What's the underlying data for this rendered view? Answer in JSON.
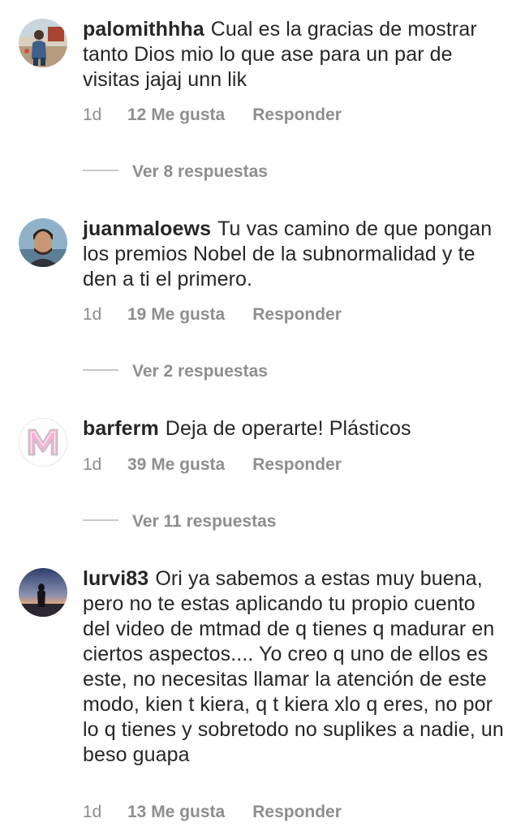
{
  "comments": [
    {
      "username": "palomithhha",
      "text": "Cual es la gracias de mostrar tanto Dios mio lo que ase para un par de visitas jajaj unn lik",
      "time": "1d",
      "likes": "12 Me gusta",
      "reply": "Responder",
      "view_replies": "Ver 8 respuestas",
      "avatar_icon": "avatar-photo-person-outdoors"
    },
    {
      "username": "juanmaloews",
      "text": "Tu vas camino de que pongan los premios Nobel de la subnormalidad y te den a ti el primero.",
      "time": "1d",
      "likes": "19 Me gusta",
      "reply": "Responder",
      "view_replies": "Ver 2 respuestas",
      "avatar_icon": "avatar-photo-man-portrait"
    },
    {
      "username": "barferm",
      "text": "Deja de operarte! Plásticos",
      "time": "1d",
      "likes": "39 Me gusta",
      "reply": "Responder",
      "view_replies": "Ver 11 respuestas",
      "avatar_icon": "avatar-letter-m"
    },
    {
      "username": "lurvi83",
      "text": "Ori ya sabemos a estas muy buena, pero no te estas aplicando tu propio cuento del video de mtmad de q tienes q madurar en ciertos aspectos.... Yo creo q uno de ellos es este, no necesitas llamar la atención de este modo, kien t kiera, q t kiera xlo q eres, no por lo q tienes y sobretodo no suplikes a nadie, un beso guapa",
      "time": "1d",
      "likes": "13 Me gusta",
      "reply": "Responder",
      "avatar_icon": "avatar-photo-sunset-silhouette"
    }
  ],
  "colors": {
    "text": "#262626",
    "meta": "#8e8e8e",
    "divider": "#c7c7c7",
    "avatar_m_pink": "#f6b3d6"
  }
}
